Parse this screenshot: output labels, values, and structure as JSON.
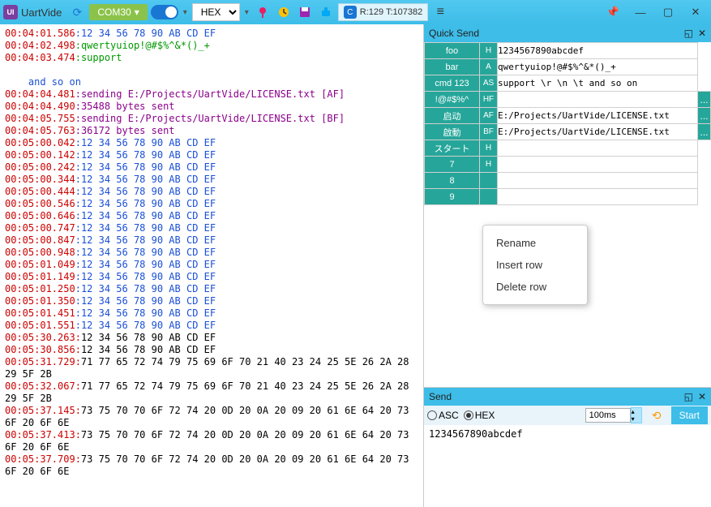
{
  "title": {
    "app": "UartVide"
  },
  "toolbar": {
    "port": "COM30",
    "view_mode": "HEX",
    "counter": "R:129 T:107382"
  },
  "console_lines": [
    {
      "t": "00:04:01.586",
      "s": ":",
      "c": "hex-tx",
      "d": "12 34 56 78 90 AB CD EF"
    },
    {
      "t": "00:04:02.498",
      "s": ":",
      "c": "grn",
      "d": "qwertyuiop!@#$%^&*()_+"
    },
    {
      "t": "00:04:03.474",
      "s": ":",
      "c": "grn",
      "d": "support"
    },
    {
      "t": "",
      "s": "",
      "c": "",
      "d": ""
    },
    {
      "t": "",
      "s": "",
      "c": "ind",
      "d": "    and so on"
    },
    {
      "t": "00:04:04.481",
      "s": ":",
      "c": "msg",
      "d": "sending E:/Projects/UartVide/LICENSE.txt [AF]"
    },
    {
      "t": "00:04:04.490",
      "s": ":",
      "c": "msg",
      "d": "35488 bytes sent"
    },
    {
      "t": "00:04:05.755",
      "s": ":",
      "c": "msg",
      "d": "sending E:/Projects/UartVide/LICENSE.txt [BF]"
    },
    {
      "t": "00:04:05.763",
      "s": ":",
      "c": "msg",
      "d": "36172 bytes sent"
    },
    {
      "t": "00:05:00.042",
      "s": ":",
      "c": "hex-tx",
      "d": "12 34 56 78 90 AB CD EF"
    },
    {
      "t": "00:05:00.142",
      "s": ":",
      "c": "hex-tx",
      "d": "12 34 56 78 90 AB CD EF"
    },
    {
      "t": "00:05:00.242",
      "s": ":",
      "c": "hex-tx",
      "d": "12 34 56 78 90 AB CD EF"
    },
    {
      "t": "00:05:00.344",
      "s": ":",
      "c": "hex-tx",
      "d": "12 34 56 78 90 AB CD EF"
    },
    {
      "t": "00:05:00.444",
      "s": ":",
      "c": "hex-tx",
      "d": "12 34 56 78 90 AB CD EF"
    },
    {
      "t": "00:05:00.546",
      "s": ":",
      "c": "hex-tx",
      "d": "12 34 56 78 90 AB CD EF"
    },
    {
      "t": "00:05:00.646",
      "s": ":",
      "c": "hex-tx",
      "d": "12 34 56 78 90 AB CD EF"
    },
    {
      "t": "00:05:00.747",
      "s": ":",
      "c": "hex-tx",
      "d": "12 34 56 78 90 AB CD EF"
    },
    {
      "t": "00:05:00.847",
      "s": ":",
      "c": "hex-tx",
      "d": "12 34 56 78 90 AB CD EF"
    },
    {
      "t": "00:05:00.948",
      "s": ":",
      "c": "hex-tx",
      "d": "12 34 56 78 90 AB CD EF"
    },
    {
      "t": "00:05:01.049",
      "s": ":",
      "c": "hex-tx",
      "d": "12 34 56 78 90 AB CD EF"
    },
    {
      "t": "00:05:01.149",
      "s": ":",
      "c": "hex-tx",
      "d": "12 34 56 78 90 AB CD EF"
    },
    {
      "t": "00:05:01.250",
      "s": ":",
      "c": "hex-tx",
      "d": "12 34 56 78 90 AB CD EF"
    },
    {
      "t": "00:05:01.350",
      "s": ":",
      "c": "hex-tx",
      "d": "12 34 56 78 90 AB CD EF"
    },
    {
      "t": "00:05:01.451",
      "s": ":",
      "c": "hex-tx",
      "d": "12 34 56 78 90 AB CD EF"
    },
    {
      "t": "00:05:01.551",
      "s": ":",
      "c": "hex-tx",
      "d": "12 34 56 78 90 AB CD EF"
    },
    {
      "t": "00:05:30.263",
      "s": ":",
      "c": "",
      "d": "12 34 56 78 90 AB CD EF"
    },
    {
      "t": "00:05:30.856",
      "s": ":",
      "c": "",
      "d": "12 34 56 78 90 AB CD EF"
    }
  ],
  "wrap_lines": [
    {
      "t": "00:05:31.729",
      "d": "71 77 65 72 74 79 75 69 6F 70 21 40 23 24 25 5E 26 2A 28",
      "w": "29 5F 2B"
    },
    {
      "t": "00:05:32.067",
      "d": "71 77 65 72 74 79 75 69 6F 70 21 40 23 24 25 5E 26 2A 28",
      "w": "29 5F 2B"
    },
    {
      "t": "00:05:37.145",
      "d": "73 75 70 70 6F 72 74 20 0D 20 0A 20 09 20 61 6E 64 20 73",
      "w": "6F 20 6F 6E"
    },
    {
      "t": "00:05:37.413",
      "d": "73 75 70 70 6F 72 74 20 0D 20 0A 20 09 20 61 6E 64 20 73",
      "w": "6F 20 6F 6E"
    },
    {
      "t": "00:05:37.709",
      "d": "73 75 70 70 6F 72 74 20 0D 20 0A 20 09 20 61 6E 64 20 73",
      "w": "6F 20 6F 6E"
    }
  ],
  "quick_send": {
    "title": "Quick Send",
    "rows": [
      {
        "label": "foo",
        "fmt": "H",
        "data": "1234567890abcdef",
        "p": ""
      },
      {
        "label": "bar",
        "fmt": "A",
        "data": "qwertyuiop!@#$%^&*()_+",
        "p": ""
      },
      {
        "label": "cmd 123",
        "fmt": "AS",
        "data": "support \\r \\n \\t and so on",
        "p": ""
      },
      {
        "label": "!@#$%^",
        "fmt": "HF",
        "data": "",
        "p": "..."
      },
      {
        "label": "启动",
        "fmt": "AF",
        "data": "E:/Projects/UartVide/LICENSE.txt",
        "p": "..."
      },
      {
        "label": "啟動",
        "fmt": "BF",
        "data": "E:/Projects/UartVide/LICENSE.txt",
        "p": "..."
      },
      {
        "label": "スタート",
        "fmt": "H",
        "data": "",
        "p": ""
      },
      {
        "label": "7",
        "fmt": "H",
        "data": "",
        "p": ""
      },
      {
        "label": "8",
        "fmt": "",
        "data": "",
        "p": ""
      },
      {
        "label": "9",
        "fmt": "",
        "data": "",
        "p": ""
      }
    ]
  },
  "context": {
    "rename": "Rename",
    "insert": "Insert row",
    "delete": "Delete row"
  },
  "send": {
    "title": "Send",
    "asc": "ASC",
    "hex": "HEX",
    "interval": "100ms",
    "start": "Start",
    "text": "1234567890abcdef"
  }
}
